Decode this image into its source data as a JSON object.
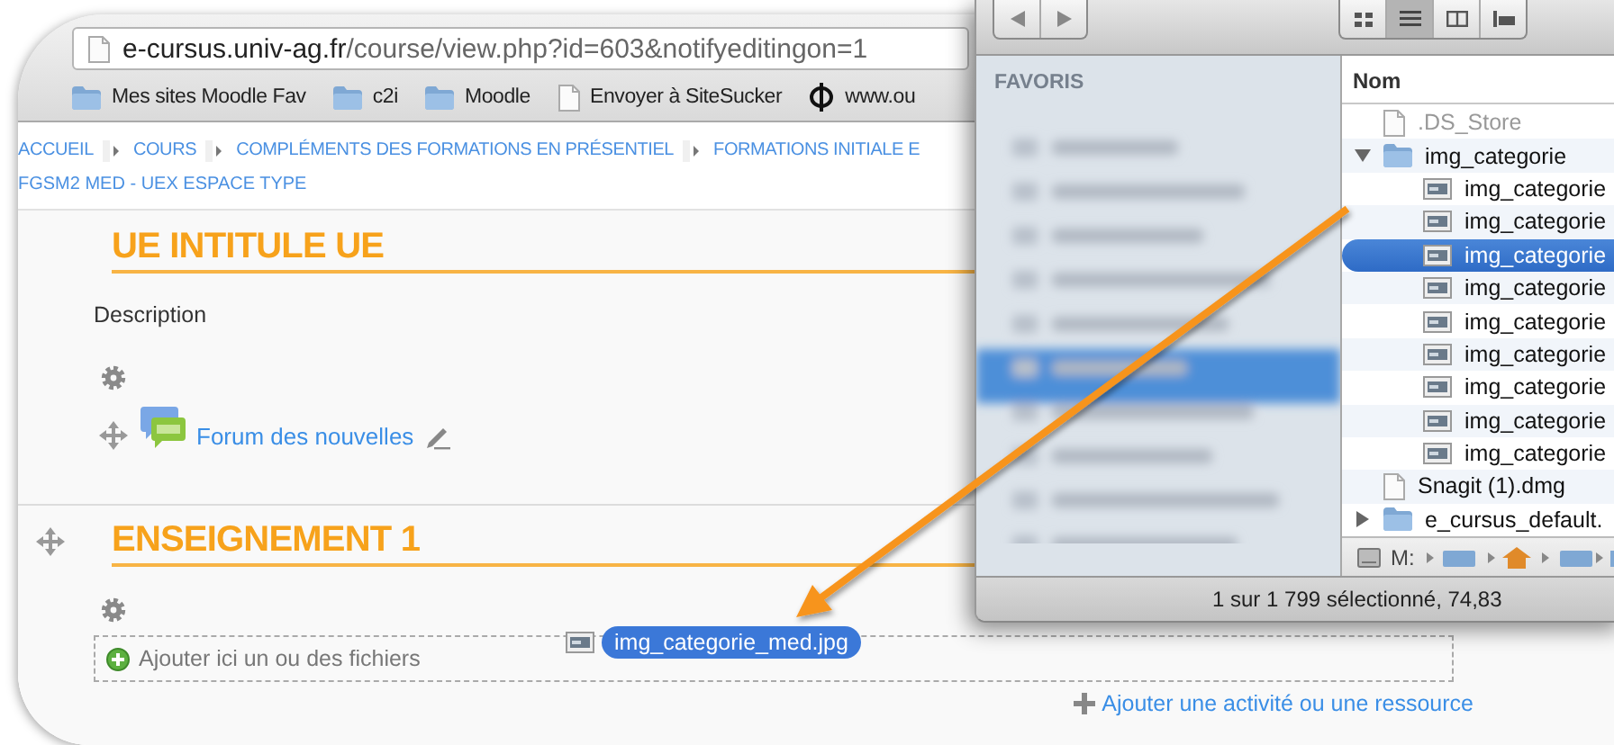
{
  "browser": {
    "address": {
      "host": "e-cursus.univ-ag.fr",
      "path": "/course/view.php?id=603&notifyeditingon=1"
    },
    "bookmarks": [
      {
        "kind": "folder",
        "label": "Mes sites Moodle Fav"
      },
      {
        "kind": "folder",
        "label": "c2i"
      },
      {
        "kind": "folder",
        "label": "Moodle"
      },
      {
        "kind": "page",
        "label": "Envoyer à SiteSucker"
      },
      {
        "kind": "site",
        "label": "www.ou"
      }
    ],
    "breadcrumbs": [
      "ACCUEIL",
      "COURS",
      "COMPLÉMENTS DES FORMATIONS EN PRÉSENTIEL",
      "FORMATIONS INITIALE E"
    ],
    "breadcrumb_current": "FGSM2 MED - UEX ESPACE TYPE",
    "sections": [
      {
        "title": "UE INTITULE UE",
        "summary": "Description",
        "activities": [
          {
            "label": "Forum des nouvelles"
          }
        ]
      },
      {
        "title": "ENSEIGNEMENT 1",
        "dropzone": "Ajouter ici un ou des fichiers",
        "add_link": "Ajouter une activité ou une ressource"
      }
    ]
  },
  "finder": {
    "sidebar_header": "FAVORIS",
    "column_header": "Nom",
    "files": [
      {
        "kind": "file",
        "name": ".DS_Store",
        "disabled": true,
        "selected": false
      },
      {
        "kind": "folder",
        "name": "img_categorie",
        "expanded": true,
        "disabled": false,
        "selected": false,
        "children": [
          {
            "name": "img_categorie",
            "selected": false
          },
          {
            "name": "img_categorie",
            "selected": false
          },
          {
            "name": "img_categorie",
            "selected": true
          },
          {
            "name": "img_categorie",
            "selected": false
          },
          {
            "name": "img_categorie",
            "selected": false
          },
          {
            "name": "img_categorie",
            "selected": false
          },
          {
            "name": "img_categorie",
            "selected": false
          },
          {
            "name": "img_categorie",
            "selected": false
          },
          {
            "name": "img_categorie",
            "selected": false
          }
        ]
      },
      {
        "kind": "file",
        "name": "Snagit (1).dmg",
        "disabled": false,
        "selected": false
      },
      {
        "kind": "folder",
        "name": "e_cursus_default.",
        "expanded": false,
        "disabled": false,
        "selected": false
      }
    ],
    "path_bar": "M:",
    "status": "1 sur 1 799 sélectionné, 74,83"
  },
  "drag": {
    "filename": "img_categorie_med.jpg"
  }
}
